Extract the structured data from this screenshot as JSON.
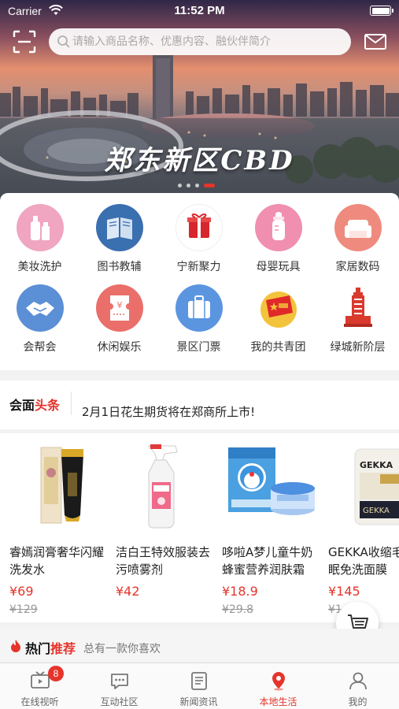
{
  "status_bar": {
    "carrier": "Carrier",
    "time": "11:52 PM"
  },
  "search": {
    "placeholder": "请输入商品名称、优惠内容、融伙伴简介"
  },
  "banner": {
    "title": "郑东新区CBD",
    "page_count": 4,
    "active_index": 3
  },
  "categories": [
    {
      "label": "美妆洗护",
      "icon": "cosmetics-icon"
    },
    {
      "label": "图书教辅",
      "icon": "book-icon"
    },
    {
      "label": "宁新聚力",
      "icon": "gift-icon"
    },
    {
      "label": "母婴玩具",
      "icon": "baby-bottle-icon"
    },
    {
      "label": "家居数码",
      "icon": "sofa-icon"
    },
    {
      "label": "会帮会",
      "icon": "handshake-icon"
    },
    {
      "label": "休闲娱乐",
      "icon": "ticket-icon"
    },
    {
      "label": "景区门票",
      "icon": "luggage-icon"
    },
    {
      "label": "我的共青团",
      "icon": "youth-league-flag-icon"
    },
    {
      "label": "绿城新阶层",
      "icon": "tower-icon"
    }
  ],
  "headline": {
    "brand_part1": "会面",
    "brand_part2": "头条",
    "news": "2月1日花生期货将在郑商所上市!"
  },
  "products": [
    {
      "name": "睿嫣润膏奢华闪耀洗发水",
      "price": "¥69",
      "original_price": "¥129"
    },
    {
      "name": "洁白王特效服装去污喷雾剂",
      "price": "¥42",
      "original_price": ""
    },
    {
      "name": "哆啦A梦儿童牛奶蜂蜜营养润肤霜",
      "price": "¥18.9",
      "original_price": "¥29.8"
    },
    {
      "name": "GEKKA收缩毛孔睡眠免洗面膜",
      "price": "¥145",
      "original_price": "¥1"
    }
  ],
  "hot": {
    "title_part1": "热门",
    "title_part2": "推荐",
    "subtitle": "总有一款你喜欢"
  },
  "tabs": [
    {
      "label": "在线视听",
      "icon": "tv-icon",
      "badge": "8"
    },
    {
      "label": "互动社区",
      "icon": "chat-icon"
    },
    {
      "label": "新闻资讯",
      "icon": "news-icon"
    },
    {
      "label": "本地生活",
      "icon": "location-pin-icon",
      "active": true
    },
    {
      "label": "我的",
      "icon": "person-icon"
    }
  ],
  "colors": {
    "accent": "#e5342b",
    "pink": "#ee8fb0",
    "blue": "#3a7fc4"
  }
}
